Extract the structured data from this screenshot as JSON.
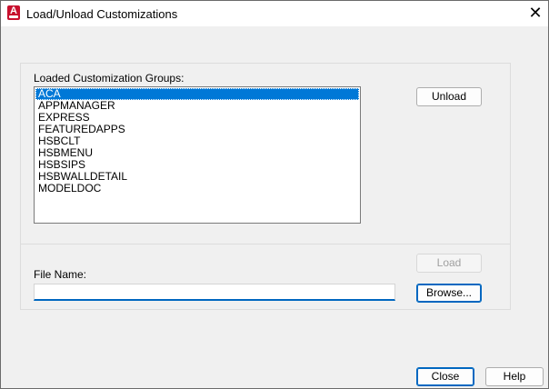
{
  "window": {
    "title": "Load/Unload Customizations",
    "app_icon": "A",
    "close_glyph": "✕"
  },
  "groups": {
    "label": "Loaded Customization Groups:",
    "items": [
      "ACA",
      "APPMANAGER",
      "EXPRESS",
      "FEATUREDAPPS",
      "HSBCLT",
      "HSBMENU",
      "HSBSIPS",
      "HSBWALLDETAIL",
      "MODELDOC"
    ],
    "selected": "ACA"
  },
  "buttons": {
    "unload": "Unload",
    "load": "Load",
    "browse": "Browse...",
    "close": "Close",
    "help": "Help"
  },
  "file": {
    "label": "File Name:",
    "value": ""
  }
}
